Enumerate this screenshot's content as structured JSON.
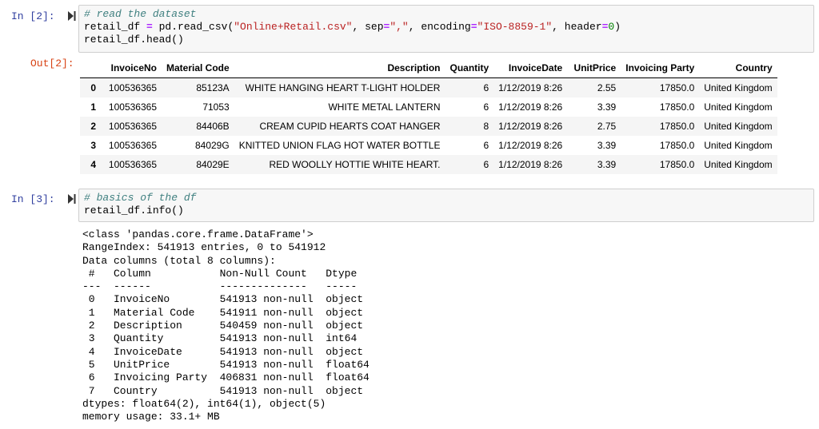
{
  "cell1": {
    "in_prompt": "In [2]:",
    "out_prompt": "Out[2]:",
    "code_comment": "# read the dataset",
    "code_line2_a": "retail_df ",
    "code_line2_eq": "=",
    "code_line2_b": " pd.read_csv(",
    "code_line2_s1": "\"Online+Retail.csv\"",
    "code_line2_c": ", sep",
    "code_line2_eq2": "=",
    "code_line2_s2": "\",\"",
    "code_line2_d": ", encoding",
    "code_line2_eq3": "=",
    "code_line2_s3": "\"ISO-8859-1\"",
    "code_line2_e": ", header",
    "code_line2_eq4": "=",
    "code_line2_n": "0",
    "code_line2_f": ")",
    "code_line3": "retail_df.head()"
  },
  "dataframe": {
    "columns": [
      "",
      "InvoiceNo",
      "Material Code",
      "Description",
      "Quantity",
      "InvoiceDate",
      "UnitPrice",
      "Invoicing Party",
      "Country"
    ],
    "rows": [
      [
        "0",
        "100536365",
        "85123A",
        "WHITE HANGING HEART T-LIGHT HOLDER",
        "6",
        "1/12/2019 8:26",
        "2.55",
        "17850.0",
        "United Kingdom"
      ],
      [
        "1",
        "100536365",
        "71053",
        "WHITE METAL LANTERN",
        "6",
        "1/12/2019 8:26",
        "3.39",
        "17850.0",
        "United Kingdom"
      ],
      [
        "2",
        "100536365",
        "84406B",
        "CREAM CUPID HEARTS COAT HANGER",
        "8",
        "1/12/2019 8:26",
        "2.75",
        "17850.0",
        "United Kingdom"
      ],
      [
        "3",
        "100536365",
        "84029G",
        "KNITTED UNION FLAG HOT WATER BOTTLE",
        "6",
        "1/12/2019 8:26",
        "3.39",
        "17850.0",
        "United Kingdom"
      ],
      [
        "4",
        "100536365",
        "84029E",
        "RED WOOLLY HOTTIE WHITE HEART.",
        "6",
        "1/12/2019 8:26",
        "3.39",
        "17850.0",
        "United Kingdom"
      ]
    ]
  },
  "cell2": {
    "in_prompt": "In [3]:",
    "code_comment": "# basics of the df",
    "code_line2": "retail_df.info()"
  },
  "info_output": {
    "lines": [
      "<class 'pandas.core.frame.DataFrame'>",
      "RangeIndex: 541913 entries, 0 to 541912",
      "Data columns (total 8 columns):",
      " #   Column           Non-Null Count   Dtype  ",
      "---  ------           --------------   -----  ",
      " 0   InvoiceNo        541913 non-null  object ",
      " 1   Material Code    541911 non-null  object ",
      " 2   Description      540459 non-null  object ",
      " 3   Quantity         541913 non-null  int64  ",
      " 4   InvoiceDate      541913 non-null  object ",
      " 5   UnitPrice        541913 non-null  float64",
      " 6   Invoicing Party  406831 non-null  float64",
      " 7   Country          541913 non-null  object ",
      "dtypes: float64(2), int64(1), object(5)",
      "memory usage: 33.1+ MB"
    ]
  },
  "icons": {
    "run": "run-cell-icon"
  },
  "colors": {
    "in_prompt": "#303F9F",
    "out_prompt": "#D84315",
    "comment": "#408080",
    "string": "#BA2121",
    "number": "#008000",
    "operator": "#AA22FF"
  }
}
